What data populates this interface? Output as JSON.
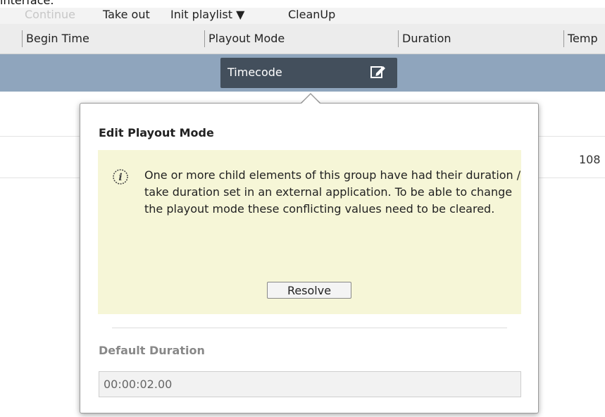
{
  "top_caption": "interface.",
  "toolbar": {
    "continue_label": "Continue",
    "take_out_label": "Take out",
    "init_playlist_label": "Init playlist ▼",
    "cleanup_label": "CleanUp"
  },
  "columns": {
    "begin_time": "Begin Time",
    "playout_mode": "Playout Mode",
    "duration": "Duration",
    "temp": "Temp"
  },
  "selected_row": {
    "playout_mode_value": "Timecode"
  },
  "row_value": "108",
  "popup": {
    "title": "Edit Playout Mode",
    "warning_text": "One or more child elements of this group have had their duration / take duration set in an external application. To be able to change the playout mode these conflicting values need to be cleared.",
    "resolve_label": "Resolve",
    "default_duration_label": "Default Duration",
    "default_duration_value": "00:00:02.00"
  },
  "icons": {
    "edit": "edit-icon",
    "info": "info-icon"
  },
  "colors": {
    "selected_row": "#8fa5bd",
    "pill": "#434f5c",
    "warning_bg": "#f6f6d7"
  }
}
